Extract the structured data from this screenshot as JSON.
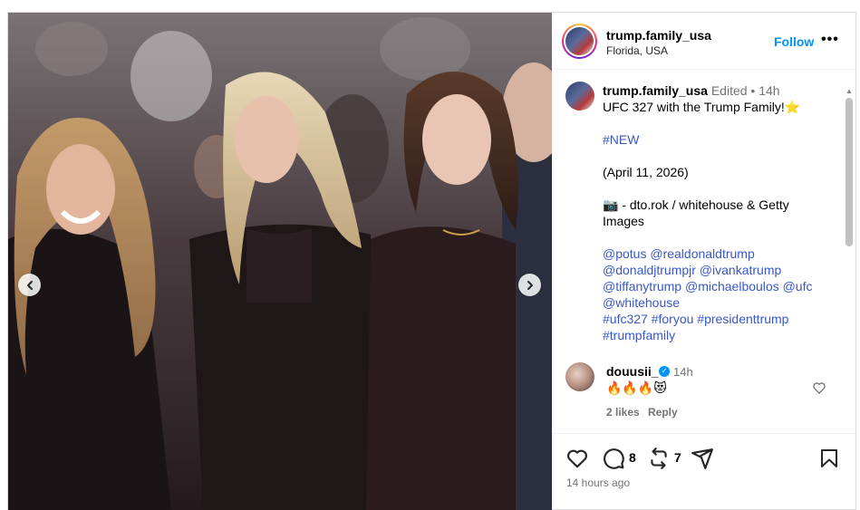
{
  "post": {
    "username": "trump.family_usa",
    "location": "Florida, USA",
    "follow_label": "Follow",
    "more_label": "•••",
    "caption": {
      "username": "trump.family_usa",
      "edited_label": "Edited",
      "separator": "•",
      "time": "14h",
      "line1": "UFC 327 with the Trump Family!⭐",
      "hashtag_new": "#NEW",
      "date_line": "(April 11, 2026)",
      "credit_line1": "📷 - dto.rok / whitehouse & Getty",
      "credit_line2": "Images",
      "mentions_line1": "@potus @realdonaldtrump",
      "mentions_line2": "@donaldjtrumpjr @ivankatrump",
      "mentions_line3": "@tiffanytrump @michaelboulos @ufc",
      "mentions_line4": "@whitehouse",
      "hashtags_line1": "#ufc327 #foryou #presidenttrump",
      "hashtags_line2": "#trumpfamily"
    },
    "comment": {
      "username": "douusii_",
      "verified_mark": "✓",
      "time": "14h",
      "text": "🔥🔥🔥😻",
      "likes": "2 likes",
      "reply_label": "Reply"
    },
    "actions": {
      "comments_count": "8",
      "reposts_count": "7",
      "time_ago": "14 hours ago"
    },
    "scroll": {
      "up": "▲",
      "down": "▼"
    },
    "colors": {
      "link": "#3957c7",
      "follow": "#0095f6",
      "muted": "#737373"
    }
  }
}
